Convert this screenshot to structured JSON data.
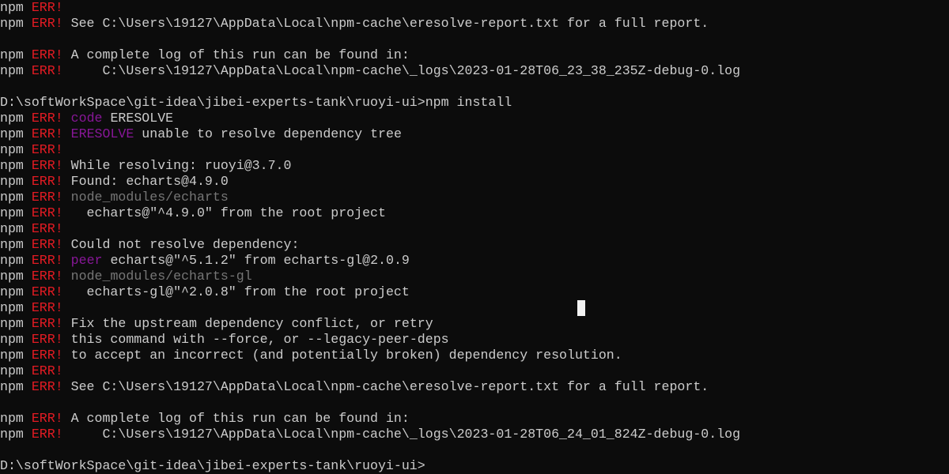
{
  "window": {
    "type": "command-prompt terminal"
  },
  "colors": {
    "background": "#0c0c0c",
    "text": "#cccccc",
    "red": "#e31b23",
    "purple": "#881798",
    "gray": "#767676"
  },
  "terminal": {
    "lines": [
      [
        [
          "npm ",
          "white"
        ],
        [
          "ERR!",
          "red"
        ]
      ],
      [
        [
          "npm ",
          "white"
        ],
        [
          "ERR!",
          "red"
        ],
        [
          " See C:\\Users\\19127\\AppData\\Local\\npm-cache\\eresolve-report.txt for a full report.",
          "white"
        ]
      ],
      [],
      [
        [
          "npm ",
          "white"
        ],
        [
          "ERR!",
          "red"
        ],
        [
          " A complete log of this run can be found in:",
          "white"
        ]
      ],
      [
        [
          "npm ",
          "white"
        ],
        [
          "ERR!",
          "red"
        ],
        [
          "     C:\\Users\\19127\\AppData\\Local\\npm-cache\\_logs\\2023-01-28T06_23_38_235Z-debug-0.log",
          "white"
        ]
      ],
      [],
      [
        [
          "D:\\softWorkSpace\\git-idea\\jibei-experts-tank\\ruoyi-ui>npm install",
          "white"
        ]
      ],
      [
        [
          "npm ",
          "white"
        ],
        [
          "ERR!",
          "red"
        ],
        [
          " ",
          "white"
        ],
        [
          "code",
          "purple"
        ],
        [
          " ERESOLVE",
          "white"
        ]
      ],
      [
        [
          "npm ",
          "white"
        ],
        [
          "ERR!",
          "red"
        ],
        [
          " ",
          "white"
        ],
        [
          "ERESOLVE",
          "purple"
        ],
        [
          " unable to resolve dependency tree",
          "white"
        ]
      ],
      [
        [
          "npm ",
          "white"
        ],
        [
          "ERR!",
          "red"
        ]
      ],
      [
        [
          "npm ",
          "white"
        ],
        [
          "ERR!",
          "red"
        ],
        [
          " While resolving: ruoyi@3.7.0",
          "white"
        ]
      ],
      [
        [
          "npm ",
          "white"
        ],
        [
          "ERR!",
          "red"
        ],
        [
          " Found: echarts@4.9.0",
          "white"
        ]
      ],
      [
        [
          "npm ",
          "white"
        ],
        [
          "ERR!",
          "red"
        ],
        [
          " ",
          "white"
        ],
        [
          "node_modules/echarts",
          "gray"
        ]
      ],
      [
        [
          "npm ",
          "white"
        ],
        [
          "ERR!",
          "red"
        ],
        [
          "   echarts@\"^4.9.0\" from the root project",
          "white"
        ]
      ],
      [
        [
          "npm ",
          "white"
        ],
        [
          "ERR!",
          "red"
        ]
      ],
      [
        [
          "npm ",
          "white"
        ],
        [
          "ERR!",
          "red"
        ],
        [
          " Could not resolve dependency:",
          "white"
        ]
      ],
      [
        [
          "npm ",
          "white"
        ],
        [
          "ERR!",
          "red"
        ],
        [
          " ",
          "white"
        ],
        [
          "peer",
          "purple"
        ],
        [
          " echarts@\"^5.1.2\" from echarts-gl@2.0.9",
          "white"
        ]
      ],
      [
        [
          "npm ",
          "white"
        ],
        [
          "ERR!",
          "red"
        ],
        [
          " ",
          "white"
        ],
        [
          "node_modules/echarts-gl",
          "gray"
        ]
      ],
      [
        [
          "npm ",
          "white"
        ],
        [
          "ERR!",
          "red"
        ],
        [
          "   echarts-gl@\"^2.0.8\" from the root project",
          "white"
        ]
      ],
      [
        [
          "npm ",
          "white"
        ],
        [
          "ERR!",
          "red"
        ]
      ],
      [
        [
          "npm ",
          "white"
        ],
        [
          "ERR!",
          "red"
        ],
        [
          " Fix the upstream dependency conflict, or retry",
          "white"
        ]
      ],
      [
        [
          "npm ",
          "white"
        ],
        [
          "ERR!",
          "red"
        ],
        [
          " this command with --force, or --legacy-peer-deps",
          "white"
        ]
      ],
      [
        [
          "npm ",
          "white"
        ],
        [
          "ERR!",
          "red"
        ],
        [
          " to accept an incorrect (and potentially broken) dependency resolution.",
          "white"
        ]
      ],
      [
        [
          "npm ",
          "white"
        ],
        [
          "ERR!",
          "red"
        ]
      ],
      [
        [
          "npm ",
          "white"
        ],
        [
          "ERR!",
          "red"
        ],
        [
          " See C:\\Users\\19127\\AppData\\Local\\npm-cache\\eresolve-report.txt for a full report.",
          "white"
        ]
      ],
      [],
      [
        [
          "npm ",
          "white"
        ],
        [
          "ERR!",
          "red"
        ],
        [
          " A complete log of this run can be found in:",
          "white"
        ]
      ],
      [
        [
          "npm ",
          "white"
        ],
        [
          "ERR!",
          "red"
        ],
        [
          "     C:\\Users\\19127\\AppData\\Local\\npm-cache\\_logs\\2023-01-28T06_24_01_824Z-debug-0.log",
          "white"
        ]
      ],
      [],
      [
        [
          "D:\\softWorkSpace\\git-idea\\jibei-experts-tank\\ruoyi-ui>",
          "white"
        ]
      ]
    ]
  }
}
